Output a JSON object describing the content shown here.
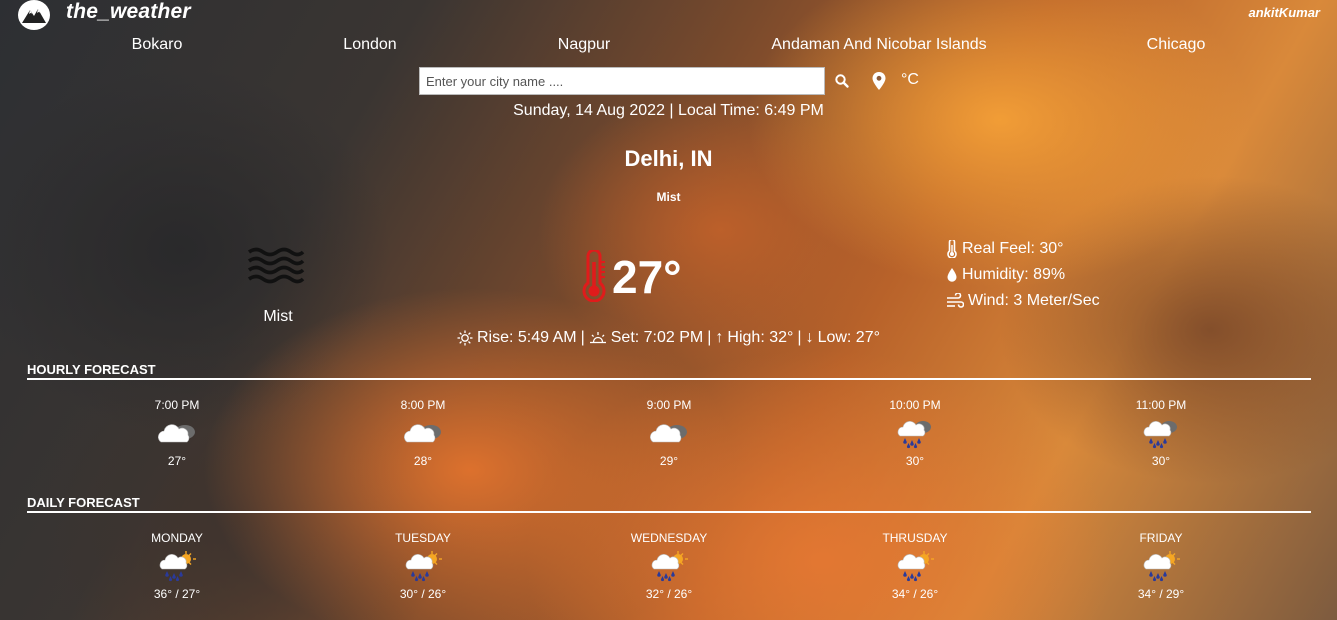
{
  "header": {
    "brand": "the_weather",
    "author": "ankitKumar",
    "logo_icon": "mountain-logo-icon"
  },
  "nav": {
    "cities": [
      "Bokaro",
      "London",
      "Nagpur",
      "Andaman And Nicobar Islands",
      "Chicago"
    ]
  },
  "search": {
    "placeholder": "Enter your city name ....",
    "value": "",
    "unit_label": "°C"
  },
  "current": {
    "datetime": "Sunday, 14 Aug 2022 | Local Time: 6:49 PM",
    "city": "Delhi, IN",
    "condition": "Mist",
    "condition_icon_label": "Mist",
    "temperature": "27°",
    "real_feel": "Real Feel: 30°",
    "humidity": "Humidity: 89%",
    "wind": "Wind: 3 Meter/Sec",
    "rise": "Rise: 5:49 AM",
    "set": "Set: 7:02 PM",
    "high": "High: 32°",
    "low": "Low: 27°",
    "separator": "|"
  },
  "hourly": {
    "title": "HOURLY FORECAST",
    "items": [
      {
        "label": "7:00 PM",
        "value": "27°",
        "icon": "cloudy"
      },
      {
        "label": "8:00 PM",
        "value": "28°",
        "icon": "cloudy"
      },
      {
        "label": "9:00 PM",
        "value": "29°",
        "icon": "cloudy"
      },
      {
        "label": "10:00 PM",
        "value": "30°",
        "icon": "rain"
      },
      {
        "label": "11:00 PM",
        "value": "30°",
        "icon": "rain"
      }
    ]
  },
  "daily": {
    "title": "DAILY FORECAST",
    "items": [
      {
        "label": "MONDAY",
        "value": "36° / 27°",
        "icon": "rain-sun"
      },
      {
        "label": "TUESDAY",
        "value": "30° / 26°",
        "icon": "rain-sun"
      },
      {
        "label": "WEDNESDAY",
        "value": "32° / 26°",
        "icon": "rain-sun"
      },
      {
        "label": "THRUSDAY",
        "value": "34° / 26°",
        "icon": "rain-sun"
      },
      {
        "label": "FRIDAY",
        "value": "34° / 29°",
        "icon": "rain-sun"
      }
    ]
  },
  "colors": {
    "thermometer": "#e01b1b",
    "rain_drop": "#2a3a9a",
    "sun": "#f5a623"
  }
}
